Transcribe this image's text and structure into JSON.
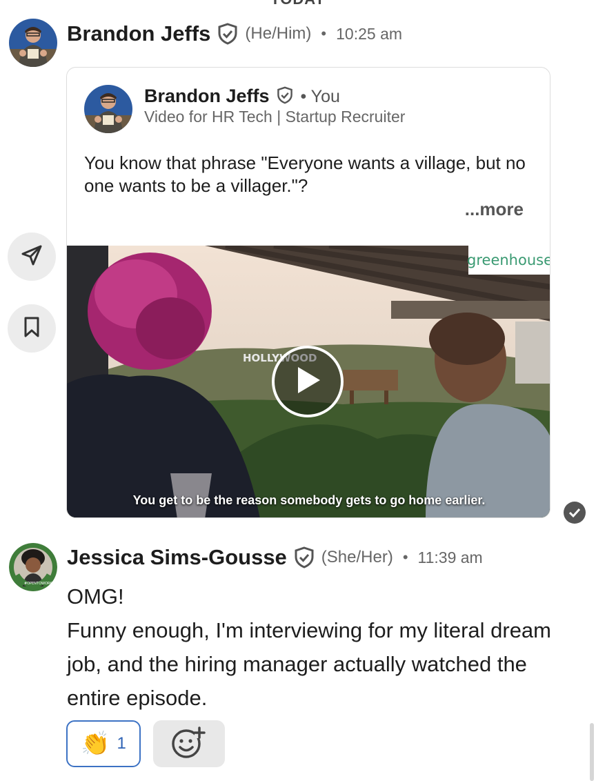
{
  "header_cutoff_text": "TODAY",
  "messages": [
    {
      "sender": "Brandon Jeffs",
      "pronouns": "(He/Him)",
      "separator": "•",
      "time": "10:25 am",
      "avatar": "person-holding-card-avatar",
      "shared_post": {
        "author": "Brandon Jeffs",
        "author_suffix": "• You",
        "subtitle": "Video for HR Tech | Startup Recruiter",
        "text": "You know that phrase \"Everyone wants a village, but no one wants to be a villager.\"?",
        "more_label": "...more",
        "video": {
          "brand_tag": "greenhouse",
          "sign_text": "HOLLYWOOD",
          "caption": "You get to be the reason somebody gets to go home earlier.",
          "play_icon": "play-icon"
        }
      },
      "status_icon": "seen-check-icon"
    },
    {
      "sender": "Jessica Sims-Gousse",
      "pronouns": "(She/Her)",
      "separator": "•",
      "time": "11:39 am",
      "avatar": "open-to-work-avatar",
      "avatar_frame_text": "#OPENTOWORK",
      "lines": [
        "OMG!",
        "Funny enough, I'm interviewing for my literal dream job, and the hiring manager actually watched the entire episode."
      ],
      "reactions": [
        {
          "emoji": "👏",
          "count": "1",
          "icon": "clapping-hands-icon"
        }
      ],
      "add_reaction_icon": "add-reaction-icon"
    }
  ],
  "side_actions": [
    {
      "icon": "send-icon"
    },
    {
      "icon": "bookmark-icon"
    }
  ],
  "colors": {
    "accent_blue": "#3c72c4",
    "verified_gray": "#555555",
    "brand_green": "#3a9a72",
    "open_to_work_green": "#3f7d3a"
  }
}
